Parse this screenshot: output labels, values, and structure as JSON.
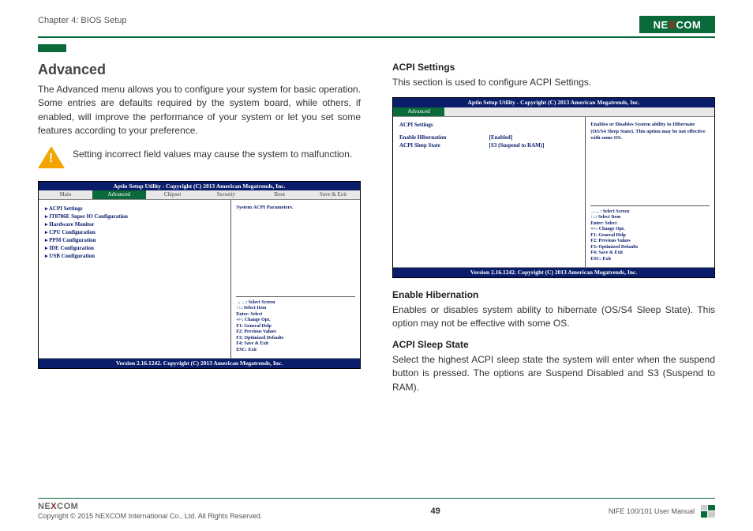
{
  "header": {
    "chapter": "Chapter 4: BIOS Setup",
    "logo_text_pre": "NE",
    "logo_text_x": "X",
    "logo_text_post": "COM"
  },
  "left": {
    "title": "Advanced",
    "intro": "The Advanced menu allows you to configure your system for basic operation. Some entries are defaults required by the system board, while others, if enabled, will improve the performance of your system or let you set some features according to your preference.",
    "warning": "Setting incorrect field values may cause the system to malfunction.",
    "bios": {
      "title": "Aptio Setup Utility - Copyright (C) 2013 American Megatrends, Inc.",
      "tabs": [
        "Main",
        "Advanced",
        "Chipset",
        "Security",
        "Boot",
        "Save & Exit"
      ],
      "active_tab": "Advanced",
      "items": [
        "▸ ACPI Settings",
        "▸ IT8786E Super IO Configuration",
        "▸ Hardware Monitor",
        "▸ CPU Configuration",
        "▸ PPM Configuration",
        "▸ IDE Configuration",
        "▸ USB Configuration"
      ],
      "help": "System ACPI Parameters.",
      "keys": [
        "→←: Select Screen",
        "↑↓: Select Item",
        "Enter: Select",
        "+/-: Change Opt.",
        "F1: General Help",
        "F2: Previous Values",
        "F3: Optimized Defaults",
        "F4: Save & Exit",
        "ESC: Exit"
      ],
      "footer": "Version 2.16.1242. Copyright (C) 2013 American Megatrends, Inc."
    }
  },
  "right": {
    "title": "ACPI Settings",
    "intro": "This section is used to configure ACPI Settings.",
    "bios": {
      "title": "Aptio Setup Utility - Copyright (C) 2013 American Megatrends, Inc.",
      "single_tab": "Advanced",
      "heading": "ACPI Settings",
      "rows": [
        {
          "label": "Enable Hibernation",
          "value": "[Enabled]"
        },
        {
          "label": "ACPI Sleep State",
          "value": "[S3 (Suspend to RAM)]"
        }
      ],
      "help": "Enables or Disables System ability to Hibernate (OS/S4 Sleep State). This option may be not effective with some OS.",
      "keys": [
        "→←: Select Screen",
        "↑↓: Select Item",
        "Enter: Select",
        "+/-: Change Opt.",
        "F1: General Help",
        "F2: Previous Values",
        "F3: Optimized Defaults",
        "F4: Save & Exit",
        "ESC: Exit"
      ],
      "footer": "Version 2.16.1242. Copyright (C) 2013 American Megatrends, Inc."
    },
    "sub1_title": "Enable Hibernation",
    "sub1_body": "Enables or disables system ability to hibernate (OS/S4 Sleep State). This option may not be effective with some OS.",
    "sub2_title": "ACPI Sleep State",
    "sub2_body": "Select the highest ACPI sleep state the system will enter when the suspend button is pressed. The options are Suspend Disabled and S3 (Suspend to RAM)."
  },
  "footer": {
    "copyright": "Copyright © 2015 NEXCOM International Co., Ltd. All Rights Reserved.",
    "page": "49",
    "doc": "NIFE 100/101 User Manual"
  }
}
